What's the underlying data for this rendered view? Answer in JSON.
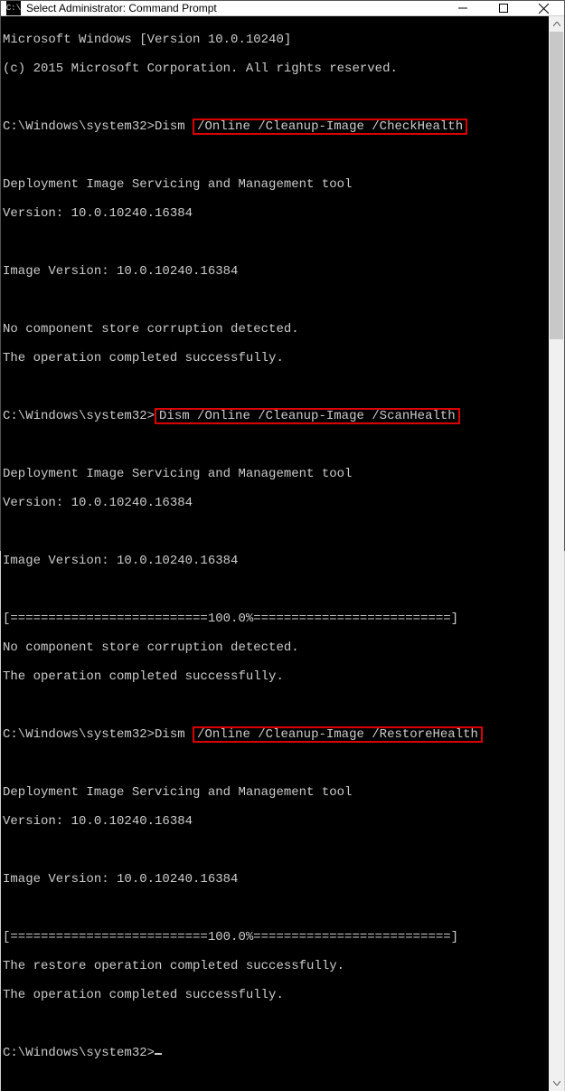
{
  "window": {
    "title": "Select Administrator: Command Prompt",
    "icon_label": "C:\\"
  },
  "terminal": {
    "line_ver1": "Microsoft Windows [Version 10.0.10240]",
    "line_copy": "(c) 2015 Microsoft Corporation. All rights reserved.",
    "prompt": "C:\\Windows\\system32>",
    "cmd1_pre": "Dism ",
    "cmd1_hl": "/Online /Cleanup-Image /CheckHealth",
    "tool_line1": "Deployment Image Servicing and Management tool",
    "tool_ver": "Version: 10.0.10240.16384",
    "img_ver": "Image Version: 10.0.10240.16384",
    "nocorrupt": "No component store corruption detected.",
    "success": "The operation completed successfully.",
    "cmd2_hl": "Dism /Online /Cleanup-Image /ScanHealth",
    "progress": "[==========================100.0%==========================]",
    "cmd3_pre": "Dism ",
    "cmd3_hl": "/Online /Cleanup-Image /RestoreHealth",
    "restore_ok": "The restore operation completed successfully."
  }
}
